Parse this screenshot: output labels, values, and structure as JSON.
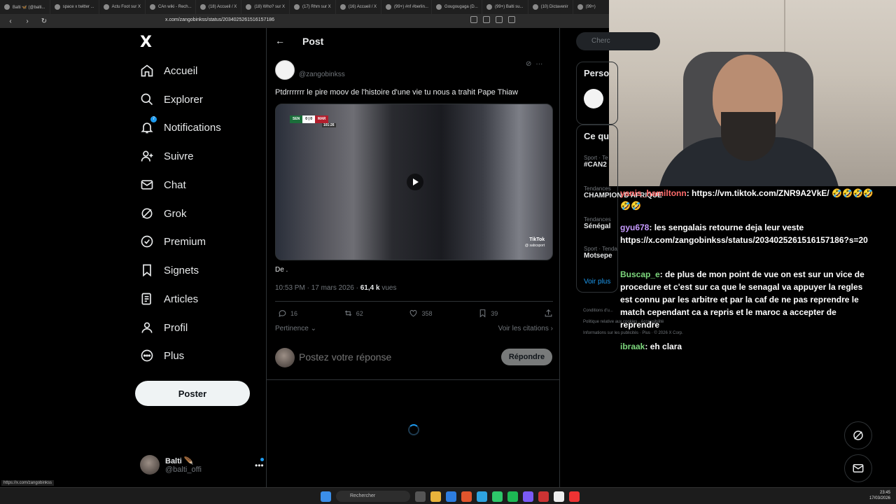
{
  "browser": {
    "tabs": [
      "Balti 🦋 (@balti...",
      "space x twitter ...",
      "Actu Foot sur X",
      "CAn wiki - Rech...",
      "(18) Accueil / X",
      "(18) Who? sur X",
      "(17) Rhm sur X",
      "(16) Accueil / X",
      "(99+) #nf #berlin...",
      "Gougougaga (D...",
      "(99+) Balti su...",
      "(10) Dictavenir",
      "(99+)"
    ],
    "url": "x.com/zangobinkss/status/2034025261516157186",
    "status_url": "https://x.com/zangobinkss"
  },
  "nav": {
    "logo": "X",
    "notif_count": "7",
    "items": [
      {
        "label": "Accueil",
        "icon": "home-icon"
      },
      {
        "label": "Explorer",
        "icon": "search-icon"
      },
      {
        "label": "Notifications",
        "icon": "bell-icon"
      },
      {
        "label": "Suivre",
        "icon": "person-add-icon"
      },
      {
        "label": "Chat",
        "icon": "mail-icon"
      },
      {
        "label": "Grok",
        "icon": "grok-icon"
      },
      {
        "label": "Premium",
        "icon": "verified-badge-icon"
      },
      {
        "label": "Signets",
        "icon": "bookmark-icon"
      },
      {
        "label": "Articles",
        "icon": "article-icon"
      },
      {
        "label": "Profil",
        "icon": "person-icon"
      },
      {
        "label": "Plus",
        "icon": "more-circle-icon"
      }
    ],
    "post_button": "Poster",
    "account": {
      "name": "Balti 🪶",
      "handle": "@balti_offi"
    }
  },
  "post": {
    "header_title": "Post",
    "author_handle": "@zangobinkss",
    "text": "Ptdrrrrrrr le pire moov de l'histoire d'une vie tu nous a trahit Pape Thiaw",
    "video": {
      "score_home": "SEN",
      "score_value": "0 | 0",
      "score_away": "MAR",
      "clock": "101:26",
      "watermark": "TikTok",
      "watermark_sub": "@ sabcsport"
    },
    "caption": "De .",
    "time": "10:53 PM · 17 mars 2026 · ",
    "views_count": "61,4 k",
    "views_label": " vues",
    "actions": {
      "replies": "16",
      "reposts": "62",
      "likes": "358",
      "bookmarks": "39"
    },
    "sort_label": "Pertinence",
    "quotes_label": "Voir les citations",
    "reply_placeholder": "Postez votre réponse",
    "reply_button": "Répondre"
  },
  "right": {
    "search_placeholder": "Cherc",
    "card1_title": "Perso",
    "card2_title": "Ce qu",
    "trends": [
      {
        "cat": "Sport · Te",
        "name": "#CAN2"
      },
      {
        "cat": "Tendances",
        "name": "CHAMPION D'AFRIQUE"
      },
      {
        "cat": "Tendances",
        "name": "Sénégal"
      },
      {
        "cat": "Sport · Tenda",
        "name": "Motsepe"
      }
    ],
    "voir_plus": "Voir plus",
    "footer": [
      "Conditions d'u...",
      "Politique relative aux cookies · Accessibilité",
      "Informations sur les publicités · Plus · © 2026 X Corp."
    ]
  },
  "chat": [
    {
      "user": "yanis_hamiltonn",
      "color": "#ff6b6b",
      "text": "https://vm.tiktok.com/ZNR9A2VkE/ 🤣🤣🤣🤣🤣🤣"
    },
    {
      "user": "gyu678",
      "color": "#c79bff",
      "text": "les sengalais retourne deja leur veste https://x.com/zangobinkss/status/2034025261516157186?s=20"
    },
    {
      "user": "Buscap_e",
      "color": "#7dd87d",
      "text": "de plus de mon point de vue on est sur un vice de procedure et c'est sur ca que le senagal va appuyer la regles est connu par les arbitre et par la caf de ne pas reprendre le match cependant ca a repris et le maroc a accepter de reprendre"
    },
    {
      "user": "ibraak",
      "color": "#7dd87d",
      "text": "eh clara"
    }
  ],
  "taskbar": {
    "search": "Rechercher",
    "time": "23:45",
    "date": "17/03/2026"
  },
  "colors": {
    "accent": "#1d9bf0",
    "background": "#000000",
    "border": "#2f3336",
    "muted": "#71767b"
  }
}
